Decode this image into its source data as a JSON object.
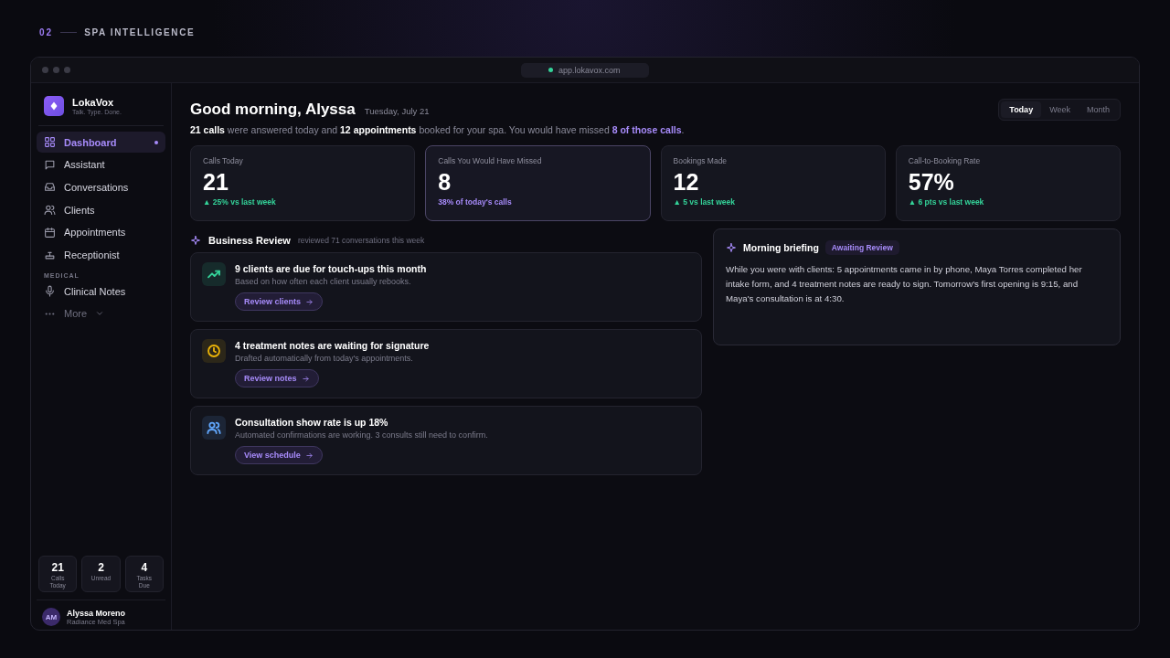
{
  "section_label": {
    "number": "02",
    "title": "SPA INTELLIGENCE"
  },
  "browser": {
    "url": "app.lokavox.com"
  },
  "sidebar": {
    "brand": {
      "name": "LokaVox",
      "tagline": "Talk. Type. Done."
    },
    "items": [
      {
        "kind": "item",
        "label": "Dashboard",
        "selected": true
      },
      {
        "kind": "item",
        "label": "Assistant",
        "selected": false
      },
      {
        "kind": "item",
        "label": "Conversations",
        "selected": false
      },
      {
        "kind": "item",
        "label": "Clients",
        "selected": false
      },
      {
        "kind": "item",
        "label": "Appointments",
        "selected": false
      },
      {
        "kind": "item",
        "label": "Receptionist",
        "selected": false
      },
      {
        "kind": "section",
        "label": "MEDICAL"
      },
      {
        "kind": "item",
        "label": "Clinical Notes",
        "selected": false
      },
      {
        "kind": "more",
        "label": "More"
      }
    ],
    "stats": [
      {
        "value": "21",
        "label": "Calls Today"
      },
      {
        "value": "2",
        "label": "Unread"
      },
      {
        "value": "4",
        "label": "Tasks Due"
      }
    ],
    "user": {
      "initials": "AM",
      "name": "Alyssa Moreno",
      "org": "Radiance Med Spa"
    }
  },
  "header": {
    "greeting": "Good morning, Alyssa",
    "date": "Tuesday, July 21",
    "periods": [
      {
        "label": "Today",
        "selected": true
      },
      {
        "label": "Week",
        "selected": false
      },
      {
        "label": "Month",
        "selected": false
      }
    ],
    "summary": [
      {
        "kind": "strong",
        "text": "21 calls"
      },
      {
        "kind": "plain",
        "text": " were answered today and "
      },
      {
        "kind": "strong",
        "text": "12 appointments"
      },
      {
        "kind": "plain",
        "text": " booked for your spa. You would have missed "
      },
      {
        "kind": "accent",
        "text": "8 of those calls"
      },
      {
        "kind": "plain",
        "text": "."
      }
    ]
  },
  "kpis": [
    {
      "label": "Calls Today",
      "value": "21",
      "delta": "▲ 25% vs last week",
      "highlighted": false
    },
    {
      "label": "Calls You Would Have Missed",
      "value": "8",
      "delta": "38% of today's calls",
      "highlighted": true
    },
    {
      "label": "Bookings Made",
      "value": "12",
      "delta": "▲ 5 vs last week",
      "highlighted": false
    },
    {
      "label": "Call-to-Booking Rate",
      "value": "57%",
      "delta": "▲ 6 pts vs last week",
      "highlighted": false
    }
  ],
  "review": {
    "title": "Business Review",
    "subtitle": "reviewed 71 conversations this week",
    "items": [
      {
        "title": "9 clients are due for touch-ups this month",
        "description": "Based on how often each client usually rebooks.",
        "action": "Review clients",
        "color": "#34d399"
      },
      {
        "title": "4 treatment notes are waiting for signature",
        "description": "Drafted automatically from today's appointments.",
        "action": "Review notes",
        "color": "#eab308"
      },
      {
        "title": "Consultation show rate is up 18%",
        "description": "Automated confirmations are working. 3 consults still need to confirm.",
        "action": "View schedule",
        "color": "#60a5fa"
      }
    ]
  },
  "briefing": {
    "title": "Morning briefing",
    "badge": "Awaiting Review",
    "text": "While you were with clients: 5 appointments came in by phone, Maya Torres completed her intake form, and 4 treatment notes are ready to sign. Tomorrow's first opening is 9:15, and Maya's consultation is at 4:30."
  }
}
